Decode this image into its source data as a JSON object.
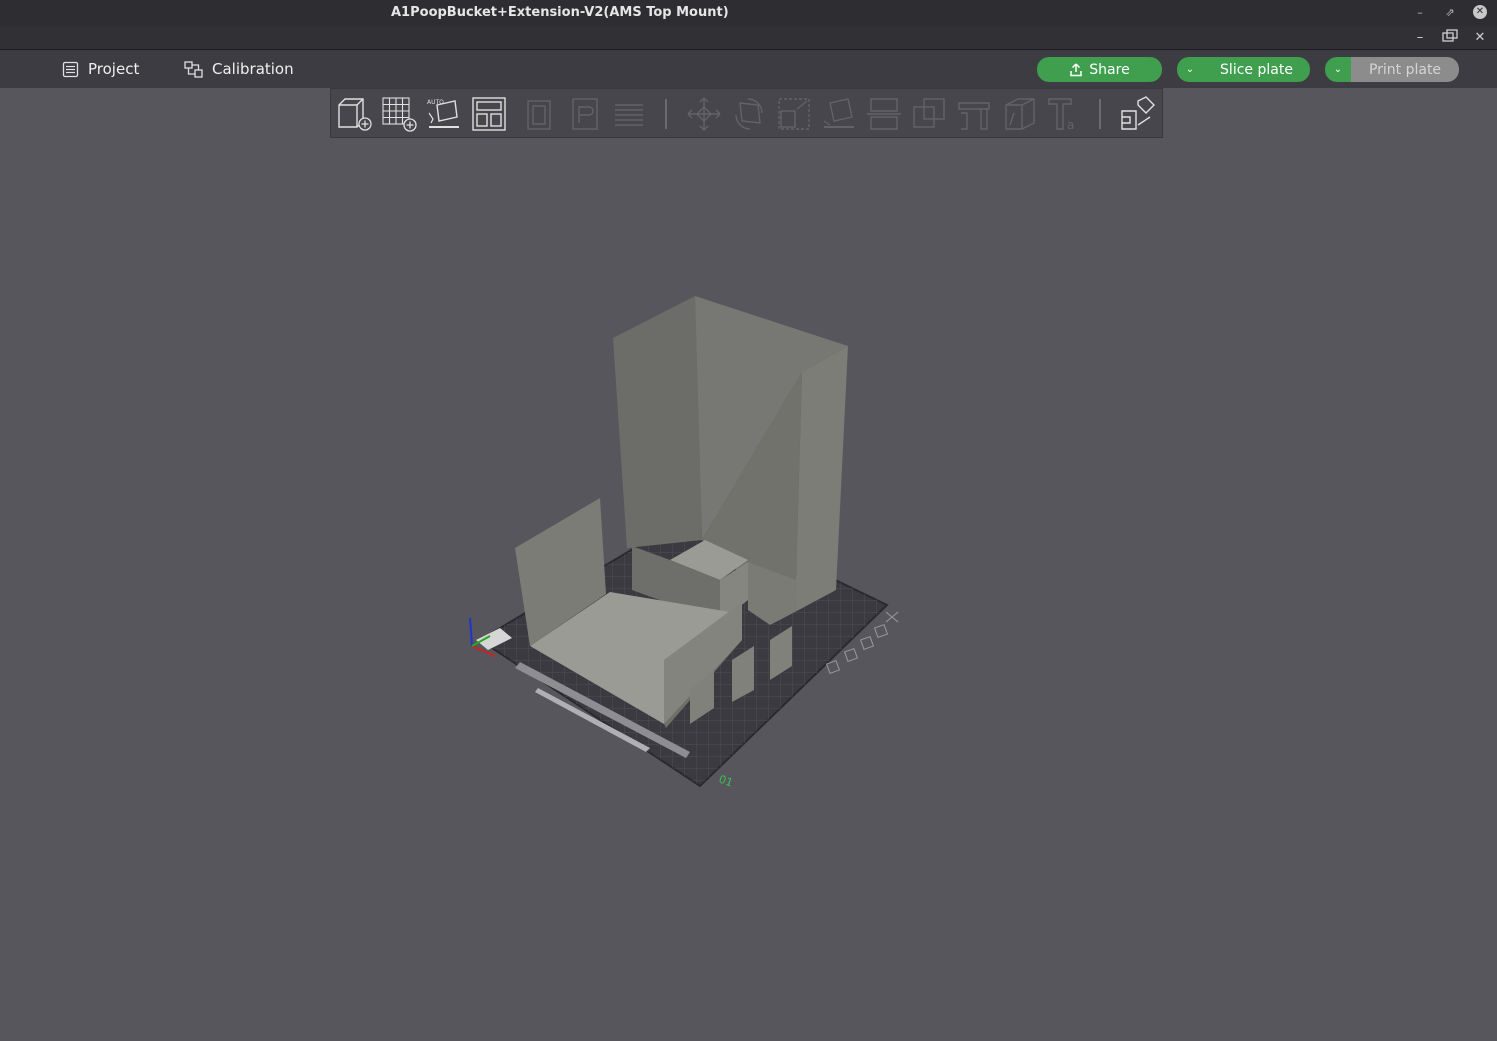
{
  "window": {
    "title": "A1PoopBucket+Extension-V2(AMS Top Mount)"
  },
  "menu": {
    "project_label": "Project",
    "calibration_label": "Calibration"
  },
  "actions": {
    "share_label": "Share",
    "slice_label": "Slice plate",
    "print_label": "Print plate"
  },
  "plate": {
    "number_label": "01"
  },
  "colors": {
    "accent_green": "#3f9f4f",
    "background": "#56565c",
    "model": "#8e8f89"
  },
  "toolbar_icons": [
    "add-object-icon",
    "add-plate-icon",
    "auto-orient-icon",
    "arrange-icon",
    "copy-icon",
    "paste-icon",
    "layers-icon",
    "move-icon",
    "rotate-icon",
    "scale-icon",
    "lay-on-face-icon",
    "cut-icon",
    "boolean-icon",
    "support-paint-icon",
    "seam-paint-icon",
    "text-icon",
    "assembly-icon"
  ]
}
